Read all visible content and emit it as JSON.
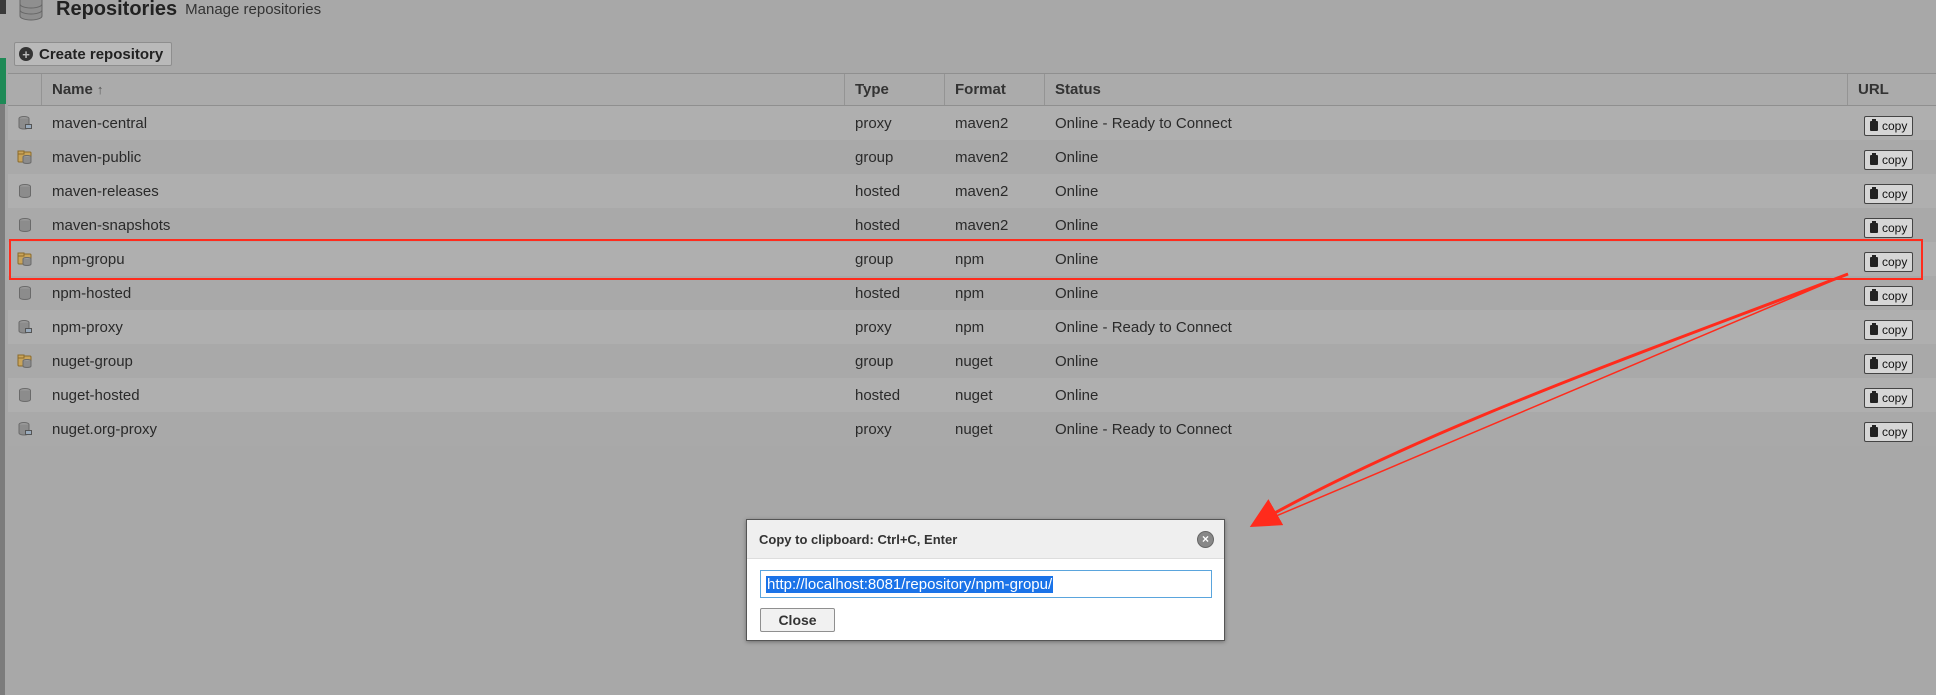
{
  "header": {
    "title": "Repositories",
    "subtitle": "Manage repositories"
  },
  "toolbar": {
    "create_label": "Create repository"
  },
  "grid": {
    "columns": [
      "Name",
      "Type",
      "Format",
      "Status",
      "URL"
    ],
    "sort_indicator": "↑",
    "copy_label": "copy",
    "rows": [
      {
        "name": "maven-central",
        "type": "proxy",
        "format": "maven2",
        "status": "Online - Ready to Connect",
        "icon": "proxy-repo-icon"
      },
      {
        "name": "maven-public",
        "type": "group",
        "format": "maven2",
        "status": "Online",
        "icon": "group-repo-icon"
      },
      {
        "name": "maven-releases",
        "type": "hosted",
        "format": "maven2",
        "status": "Online",
        "icon": "hosted-repo-icon"
      },
      {
        "name": "maven-snapshots",
        "type": "hosted",
        "format": "maven2",
        "status": "Online",
        "icon": "hosted-repo-icon"
      },
      {
        "name": "npm-gropu",
        "type": "group",
        "format": "npm",
        "status": "Online",
        "icon": "group-repo-icon"
      },
      {
        "name": "npm-hosted",
        "type": "hosted",
        "format": "npm",
        "status": "Online",
        "icon": "hosted-repo-icon"
      },
      {
        "name": "npm-proxy",
        "type": "proxy",
        "format": "npm",
        "status": "Online - Ready to Connect",
        "icon": "proxy-repo-icon"
      },
      {
        "name": "nuget-group",
        "type": "group",
        "format": "nuget",
        "status": "Online",
        "icon": "group-repo-icon"
      },
      {
        "name": "nuget-hosted",
        "type": "hosted",
        "format": "nuget",
        "status": "Online",
        "icon": "hosted-repo-icon"
      },
      {
        "name": "nuget.org-proxy",
        "type": "proxy",
        "format": "nuget",
        "status": "Online - Ready to Connect",
        "icon": "proxy-repo-icon"
      }
    ]
  },
  "dialog": {
    "title": "Copy to clipboard: Ctrl+C, Enter",
    "url_value": "http://localhost:8081/repository/npm-gropu/",
    "close_label": "Close"
  },
  "colors": {
    "highlight": "#ff2b1c",
    "selection": "#1a73e8",
    "overlay": "#a8a8a8"
  }
}
